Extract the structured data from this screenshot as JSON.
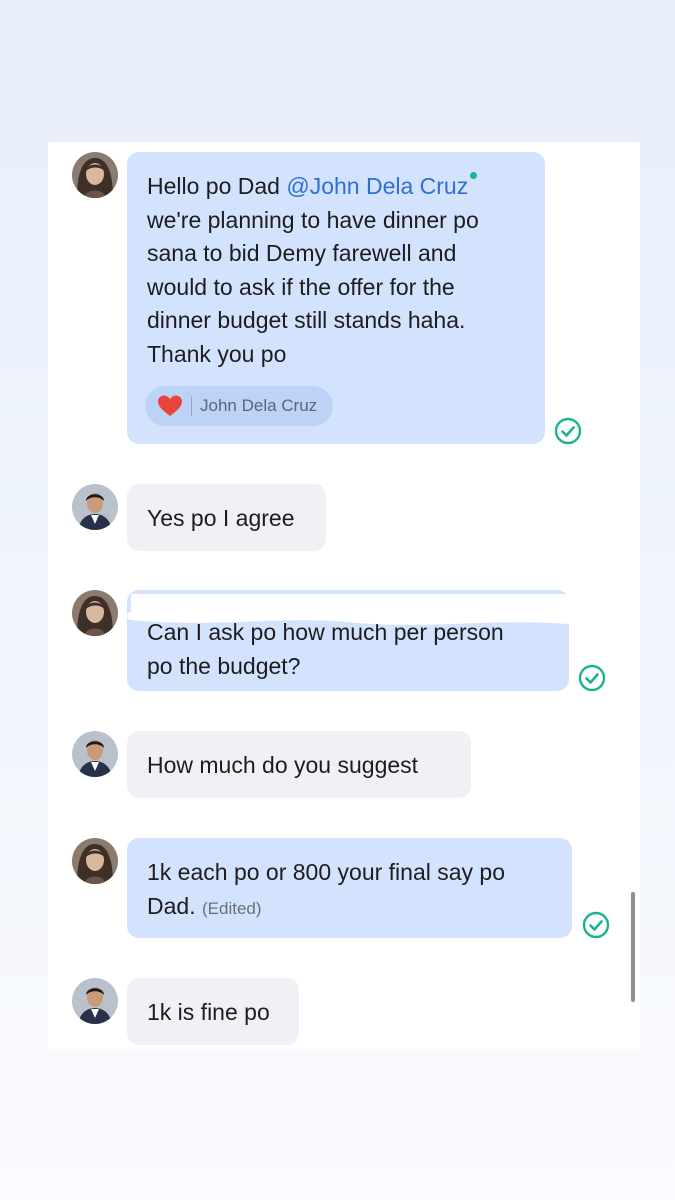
{
  "messages": [
    {
      "sender": "self",
      "avatar": "woman-avatar",
      "lines": [
        "Hello po Dad",
        "we're planning to have dinner po",
        "sana to bid Demy farewell and",
        "would to ask if the offer for the",
        "dinner budget still stands haha.",
        "Thank you po"
      ],
      "mention": "@John Dela Cruz",
      "reaction": {
        "icon": "heart-icon",
        "name": "John Dela Cruz"
      },
      "status": "read"
    },
    {
      "sender": "other",
      "avatar": "man-avatar",
      "text": "Yes po I agree"
    },
    {
      "sender": "self",
      "avatar": "woman-avatar",
      "redacted_line": "Can I ask po how much per person",
      "text": "po the budget?",
      "status": "read"
    },
    {
      "sender": "other",
      "avatar": "man-avatar",
      "text": "How much do you suggest"
    },
    {
      "sender": "self",
      "avatar": "woman-avatar",
      "lines": [
        "1k each po or 800 your final say po",
        "Dad."
      ],
      "edited_label": "(Edited)",
      "status": "read"
    },
    {
      "sender": "other",
      "avatar": "man-avatar",
      "text": "1k is fine po"
    }
  ],
  "colors": {
    "self_bubble": "#d3e3fd",
    "other_bubble": "#f0f1f4",
    "mention": "#2f6fd6",
    "read_check": "#1ab394",
    "heart": "#e8453c"
  }
}
